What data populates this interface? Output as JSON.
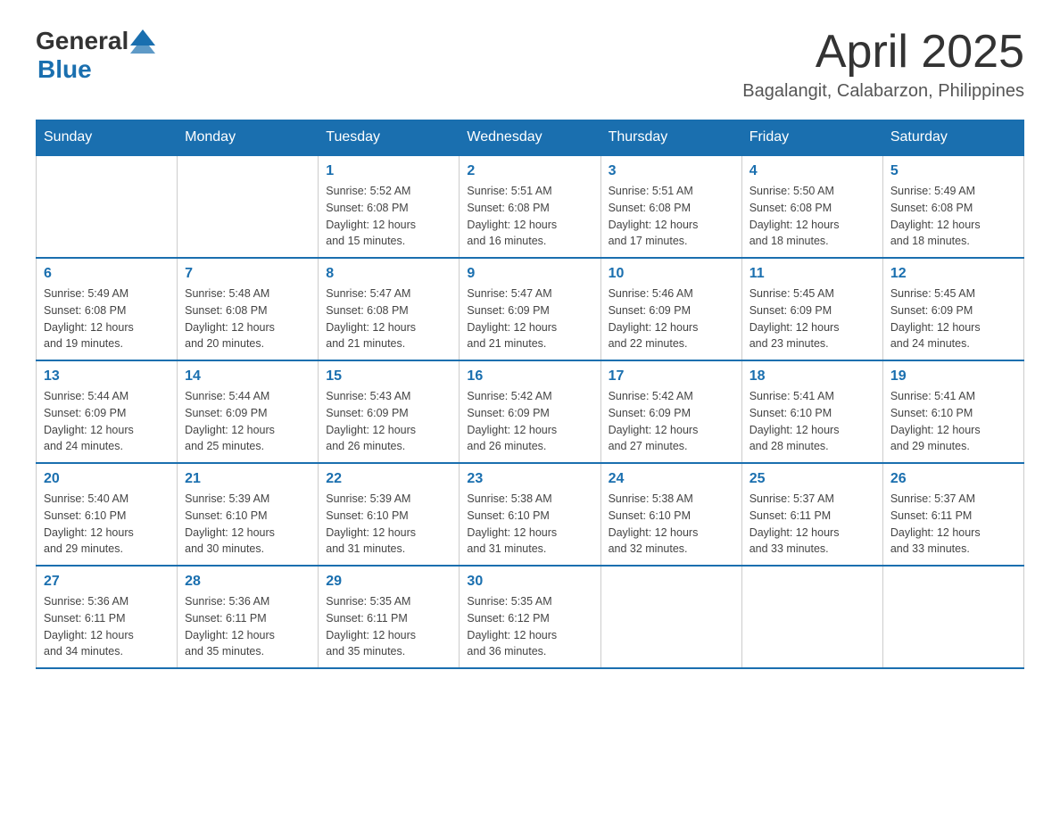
{
  "header": {
    "logo_general": "General",
    "logo_blue": "Blue",
    "month_title": "April 2025",
    "location": "Bagalangit, Calabarzon, Philippines"
  },
  "weekdays": [
    "Sunday",
    "Monday",
    "Tuesday",
    "Wednesday",
    "Thursday",
    "Friday",
    "Saturday"
  ],
  "weeks": [
    [
      {
        "day": "",
        "info": ""
      },
      {
        "day": "",
        "info": ""
      },
      {
        "day": "1",
        "info": "Sunrise: 5:52 AM\nSunset: 6:08 PM\nDaylight: 12 hours\nand 15 minutes."
      },
      {
        "day": "2",
        "info": "Sunrise: 5:51 AM\nSunset: 6:08 PM\nDaylight: 12 hours\nand 16 minutes."
      },
      {
        "day": "3",
        "info": "Sunrise: 5:51 AM\nSunset: 6:08 PM\nDaylight: 12 hours\nand 17 minutes."
      },
      {
        "day": "4",
        "info": "Sunrise: 5:50 AM\nSunset: 6:08 PM\nDaylight: 12 hours\nand 18 minutes."
      },
      {
        "day": "5",
        "info": "Sunrise: 5:49 AM\nSunset: 6:08 PM\nDaylight: 12 hours\nand 18 minutes."
      }
    ],
    [
      {
        "day": "6",
        "info": "Sunrise: 5:49 AM\nSunset: 6:08 PM\nDaylight: 12 hours\nand 19 minutes."
      },
      {
        "day": "7",
        "info": "Sunrise: 5:48 AM\nSunset: 6:08 PM\nDaylight: 12 hours\nand 20 minutes."
      },
      {
        "day": "8",
        "info": "Sunrise: 5:47 AM\nSunset: 6:08 PM\nDaylight: 12 hours\nand 21 minutes."
      },
      {
        "day": "9",
        "info": "Sunrise: 5:47 AM\nSunset: 6:09 PM\nDaylight: 12 hours\nand 21 minutes."
      },
      {
        "day": "10",
        "info": "Sunrise: 5:46 AM\nSunset: 6:09 PM\nDaylight: 12 hours\nand 22 minutes."
      },
      {
        "day": "11",
        "info": "Sunrise: 5:45 AM\nSunset: 6:09 PM\nDaylight: 12 hours\nand 23 minutes."
      },
      {
        "day": "12",
        "info": "Sunrise: 5:45 AM\nSunset: 6:09 PM\nDaylight: 12 hours\nand 24 minutes."
      }
    ],
    [
      {
        "day": "13",
        "info": "Sunrise: 5:44 AM\nSunset: 6:09 PM\nDaylight: 12 hours\nand 24 minutes."
      },
      {
        "day": "14",
        "info": "Sunrise: 5:44 AM\nSunset: 6:09 PM\nDaylight: 12 hours\nand 25 minutes."
      },
      {
        "day": "15",
        "info": "Sunrise: 5:43 AM\nSunset: 6:09 PM\nDaylight: 12 hours\nand 26 minutes."
      },
      {
        "day": "16",
        "info": "Sunrise: 5:42 AM\nSunset: 6:09 PM\nDaylight: 12 hours\nand 26 minutes."
      },
      {
        "day": "17",
        "info": "Sunrise: 5:42 AM\nSunset: 6:09 PM\nDaylight: 12 hours\nand 27 minutes."
      },
      {
        "day": "18",
        "info": "Sunrise: 5:41 AM\nSunset: 6:10 PM\nDaylight: 12 hours\nand 28 minutes."
      },
      {
        "day": "19",
        "info": "Sunrise: 5:41 AM\nSunset: 6:10 PM\nDaylight: 12 hours\nand 29 minutes."
      }
    ],
    [
      {
        "day": "20",
        "info": "Sunrise: 5:40 AM\nSunset: 6:10 PM\nDaylight: 12 hours\nand 29 minutes."
      },
      {
        "day": "21",
        "info": "Sunrise: 5:39 AM\nSunset: 6:10 PM\nDaylight: 12 hours\nand 30 minutes."
      },
      {
        "day": "22",
        "info": "Sunrise: 5:39 AM\nSunset: 6:10 PM\nDaylight: 12 hours\nand 31 minutes."
      },
      {
        "day": "23",
        "info": "Sunrise: 5:38 AM\nSunset: 6:10 PM\nDaylight: 12 hours\nand 31 minutes."
      },
      {
        "day": "24",
        "info": "Sunrise: 5:38 AM\nSunset: 6:10 PM\nDaylight: 12 hours\nand 32 minutes."
      },
      {
        "day": "25",
        "info": "Sunrise: 5:37 AM\nSunset: 6:11 PM\nDaylight: 12 hours\nand 33 minutes."
      },
      {
        "day": "26",
        "info": "Sunrise: 5:37 AM\nSunset: 6:11 PM\nDaylight: 12 hours\nand 33 minutes."
      }
    ],
    [
      {
        "day": "27",
        "info": "Sunrise: 5:36 AM\nSunset: 6:11 PM\nDaylight: 12 hours\nand 34 minutes."
      },
      {
        "day": "28",
        "info": "Sunrise: 5:36 AM\nSunset: 6:11 PM\nDaylight: 12 hours\nand 35 minutes."
      },
      {
        "day": "29",
        "info": "Sunrise: 5:35 AM\nSunset: 6:11 PM\nDaylight: 12 hours\nand 35 minutes."
      },
      {
        "day": "30",
        "info": "Sunrise: 5:35 AM\nSunset: 6:12 PM\nDaylight: 12 hours\nand 36 minutes."
      },
      {
        "day": "",
        "info": ""
      },
      {
        "day": "",
        "info": ""
      },
      {
        "day": "",
        "info": ""
      }
    ]
  ]
}
